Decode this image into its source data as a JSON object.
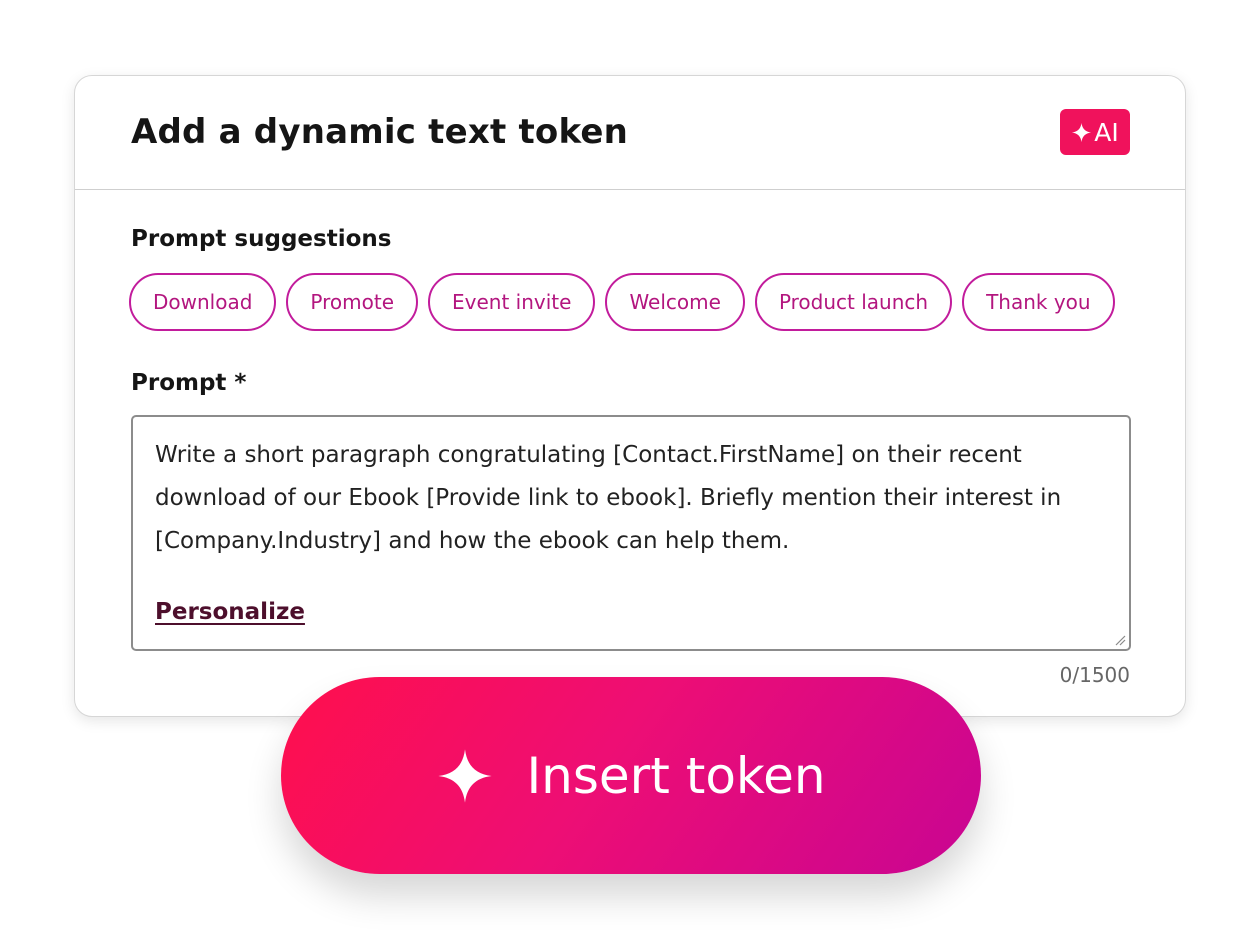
{
  "dialog": {
    "title": "Add a dynamic text token",
    "ai_badge": {
      "icon": "sparkle-icon",
      "label": "AI",
      "color": "#f0125c"
    }
  },
  "suggestions": {
    "label": "Prompt suggestions",
    "chips": [
      "Download",
      "Promote",
      "Event invite",
      "Welcome",
      "Product launch",
      "Thank you"
    ],
    "chip_color": "#c21c9c"
  },
  "prompt": {
    "label": "Prompt *",
    "value": "Write a short paragraph congratulating [Contact.FirstName] on their recent download of our Ebook [Provide link to ebook]. Briefly mention their interest in [Company.Industry] and how the ebook can help them.",
    "personalize_link": "Personalize",
    "counter": "0/1500"
  },
  "insert_button": {
    "icon": "sparkle-icon",
    "label": "Insert token",
    "gradient": [
      "#ff0f4c",
      "#ee0e74",
      "#c80593"
    ]
  }
}
